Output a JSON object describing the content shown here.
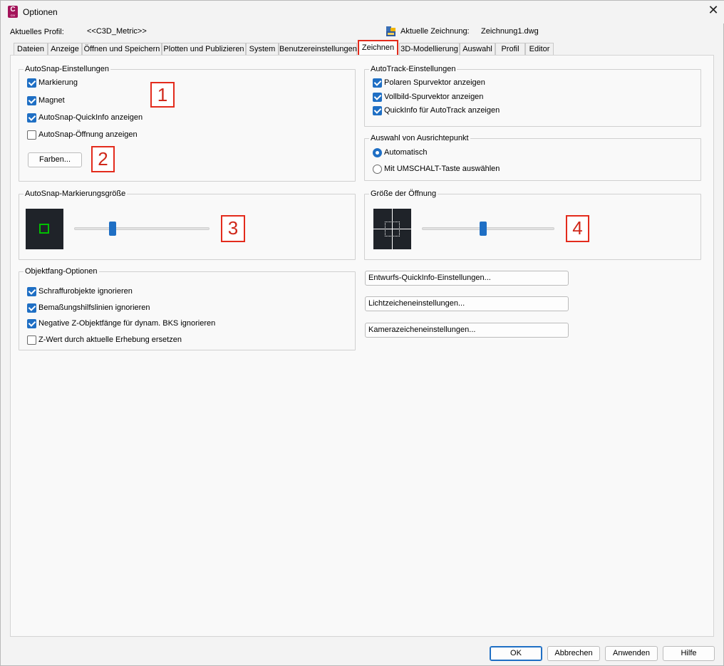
{
  "window": {
    "title": "Optionen",
    "app_icon": {
      "letter": "C",
      "sub": "CIV"
    },
    "close_glyph": "✕"
  },
  "header": {
    "profile_label": "Aktuelles Profil:",
    "profile_value": "<<C3D_Metric>>",
    "drawing_label": "Aktuelle Zeichnung:",
    "drawing_value": "Zeichnung1.dwg"
  },
  "tabs": [
    {
      "label": "Dateien"
    },
    {
      "label": "Anzeige"
    },
    {
      "label": "Öffnen und Speichern"
    },
    {
      "label": "Plotten und Publizieren"
    },
    {
      "label": "System"
    },
    {
      "label": "Benutzereinstellungen"
    },
    {
      "label": "Zeichnen",
      "active": true
    },
    {
      "label": "3D-Modellierung"
    },
    {
      "label": "Auswahl"
    },
    {
      "label": "Profil"
    },
    {
      "label": "Editor"
    }
  ],
  "autosnap": {
    "title": "AutoSnap-Einstellungen",
    "options": [
      {
        "label": "Markierung",
        "checked": true
      },
      {
        "label": "Magnet",
        "checked": true
      },
      {
        "label": "AutoSnap-QuickInfo anzeigen",
        "checked": true
      },
      {
        "label": "AutoSnap-Öffnung anzeigen",
        "checked": false
      }
    ],
    "colors_button": "Farben..."
  },
  "autotrack": {
    "title": "AutoTrack-Einstellungen",
    "options": [
      {
        "label": "Polaren Spurvektor anzeigen",
        "checked": true
      },
      {
        "label": "Vollbild-Spurvektor anzeigen",
        "checked": true
      },
      {
        "label": "QuickInfo für AutoTrack anzeigen",
        "checked": true
      }
    ]
  },
  "alignment": {
    "title": "Auswahl von Ausrichtepunkt",
    "options": [
      {
        "label": "Automatisch",
        "selected": true
      },
      {
        "label": "Mit UMSCHALT-Taste auswählen",
        "selected": false
      }
    ]
  },
  "marker_size": {
    "title": "AutoSnap-Markierungsgröße",
    "level": 0.27,
    "marker_color": "#00c000"
  },
  "aperture_size": {
    "title": "Größe der Öffnung",
    "level": 0.46
  },
  "osnap": {
    "title": "Objektfang-Optionen",
    "options": [
      {
        "label": "Schraffurobjekte ignorieren",
        "checked": true
      },
      {
        "label": "Bemaßungshilfslinien ignorieren",
        "checked": true
      },
      {
        "label": "Negative Z-Objektfänge für dynam. BKS ignorieren",
        "checked": true
      },
      {
        "label": "Z-Wert durch aktuelle Erhebung ersetzen",
        "checked": false
      }
    ]
  },
  "settings_buttons": [
    {
      "label": "Entwurfs-QuickInfo-Einstellungen..."
    },
    {
      "label": "Lichtzeicheneinstellungen..."
    },
    {
      "label": "Kamerazeicheneinstellungen..."
    }
  ],
  "footer": {
    "ok": "OK",
    "cancel": "Abbrechen",
    "apply": "Anwenden",
    "help": "Hilfe"
  },
  "annotations": [
    "1",
    "2",
    "3",
    "4"
  ],
  "colors": {
    "accent": "#1f6fc4",
    "highlight": "#e32b1c",
    "preview_bg": "#1f2329"
  }
}
